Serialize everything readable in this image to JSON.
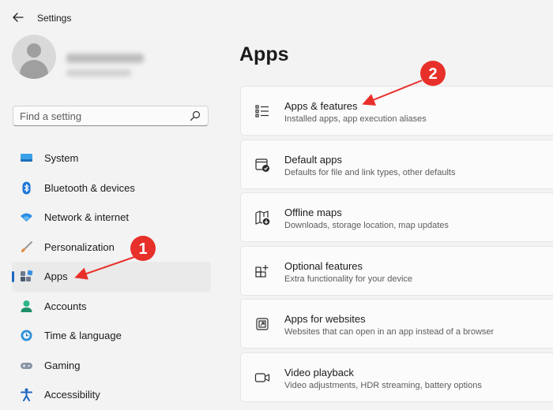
{
  "window": {
    "title": "Settings"
  },
  "search": {
    "placeholder": "Find a setting"
  },
  "sidebar": {
    "items": [
      {
        "label": "System",
        "icon": "monitor-icon",
        "color": "#2c8fd9"
      },
      {
        "label": "Bluetooth & devices",
        "icon": "bluetooth-icon",
        "color": "#1b74d4"
      },
      {
        "label": "Network & internet",
        "icon": "wifi-icon",
        "color": "#2a8ee6"
      },
      {
        "label": "Personalization",
        "icon": "brush-icon",
        "color": "#e28a3c"
      },
      {
        "label": "Apps",
        "icon": "apps-icon",
        "color": "#5f6f86",
        "selected": true
      },
      {
        "label": "Accounts",
        "icon": "person-icon",
        "color": "#2ab785"
      },
      {
        "label": "Time & language",
        "icon": "clock-globe-icon",
        "color": "#2c8fd9"
      },
      {
        "label": "Gaming",
        "icon": "gamepad-icon",
        "color": "#7e8a99"
      },
      {
        "label": "Accessibility",
        "icon": "accessibility-icon",
        "color": "#1f66c1"
      }
    ]
  },
  "main": {
    "title": "Apps",
    "cards": [
      {
        "title": "Apps & features",
        "description": "Installed apps, app execution aliases",
        "icon": "list-icon"
      },
      {
        "title": "Default apps",
        "description": "Defaults for file and link types, other defaults",
        "icon": "default-apps-icon"
      },
      {
        "title": "Offline maps",
        "description": "Downloads, storage location, map updates",
        "icon": "map-download-icon"
      },
      {
        "title": "Optional features",
        "description": "Extra functionality for your device",
        "icon": "grid-plus-icon"
      },
      {
        "title": "Apps for websites",
        "description": "Websites that can open in an app instead of a browser",
        "icon": "open-external-icon"
      },
      {
        "title": "Video playback",
        "description": "Video adjustments, HDR streaming, battery options",
        "icon": "video-camera-icon"
      }
    ]
  },
  "annotations": [
    {
      "number": "1",
      "color": "#e8302b"
    },
    {
      "number": "2",
      "color": "#e8302b"
    }
  ],
  "colors": {
    "accent": "#1f66c1",
    "background": "#f3f3f3",
    "card": "#fbfbfb",
    "callout": "#e8302b"
  }
}
